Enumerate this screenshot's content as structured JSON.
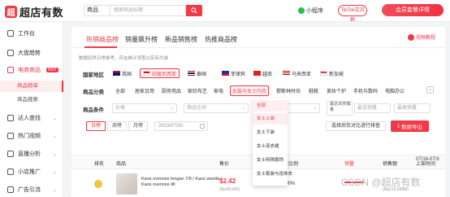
{
  "brand": {
    "name": "超店有数",
    "mark": "超"
  },
  "header": {
    "search_scope": "商品",
    "search_placeholder": "搜索商品标题",
    "mini_program": "小程序",
    "tiktok_btn": "TikTok交流群",
    "vip_btn": "会员套餐详情"
  },
  "sidebar": {
    "items": [
      {
        "label": "工作台"
      },
      {
        "label": "大盘趋势"
      },
      {
        "label": "电商商品",
        "badge": "HOT"
      },
      {
        "label": "达人查找"
      },
      {
        "label": "热门视频"
      },
      {
        "label": "直播分析"
      },
      {
        "label": "小店推广"
      },
      {
        "label": "广告引流"
      }
    ],
    "subitems": [
      {
        "label": "商品榜单"
      },
      {
        "label": "商品搜索"
      }
    ]
  },
  "tabs": [
    {
      "label": "热销商品榜"
    },
    {
      "label": "销量飙升榜"
    },
    {
      "label": "新品销售榜"
    },
    {
      "label": "热推商品榜"
    }
  ],
  "video_link": "视频教程",
  "note": "数据仅供日常参考，存在统计误差以实际为准",
  "filters": {
    "region_label": "国家地区",
    "regions": [
      {
        "label": "英国",
        "colors": [
          "#012169",
          "#c8102e"
        ]
      },
      {
        "label": "印度尼西亚",
        "colors": [
          "#ce1126",
          "#ffffff"
        ]
      },
      {
        "label": "泰国",
        "colors": [
          "#a51931",
          "#2d2a4a"
        ]
      },
      {
        "label": "菲律宾",
        "colors": [
          "#0038a8",
          "#ce1126"
        ]
      },
      {
        "label": "越南",
        "colors": [
          "#da251d",
          "#ffff00"
        ]
      },
      {
        "label": "马来西亚",
        "colors": [
          "#cc0001",
          "#010066"
        ]
      },
      {
        "label": "新加坡",
        "colors": [
          "#ef3340",
          "#ffffff"
        ]
      }
    ],
    "category_label": "商品分类",
    "categories": [
      "全部",
      "居家日用",
      "厨房用品",
      "家纺布艺",
      "家电",
      "女装与女士内衣",
      "穆斯林时尚",
      "鞋靴",
      "美妆个护",
      "手机与数码",
      "电脑办公"
    ],
    "condition_label": "商品条件",
    "price_placeholder": "价格",
    "commission_placeholder": "佣金比例",
    "sales_placeholder": "销量",
    "recent_label": "最近30天销量",
    "recent_min": "最低销量",
    "recent_max": "最高销量",
    "periods": [
      "日榜",
      "周榜",
      "月榜"
    ],
    "date": "2023/07/30",
    "toggle_btn": "选择后仅对比进行排查",
    "export_btn": "数据导出"
  },
  "dropdown": [
    {
      "label": "全部"
    },
    {
      "label": "女士上装"
    },
    {
      "label": "女士下装"
    },
    {
      "label": "女士连衣裙"
    },
    {
      "label": "女士特殊服饰"
    },
    {
      "label": "女士套装与连体衣"
    }
  ],
  "table": {
    "headers": [
      "排名",
      "商品",
      "售价",
      "佣金比例",
      "销量",
      "销售额",
      "上架时间"
    ],
    "row": {
      "title": "Kaos oversize lengan 7/8 / Kaos wanita / Kaos oversize dll",
      "price": "$2.42",
      "price_sub": "(Rp36,500)",
      "pct": "10.00%",
      "sales_sub": "(Rp219,699M)",
      "date": "07/16-07/3"
    }
  },
  "watermark": "CSDN @超店有数"
}
